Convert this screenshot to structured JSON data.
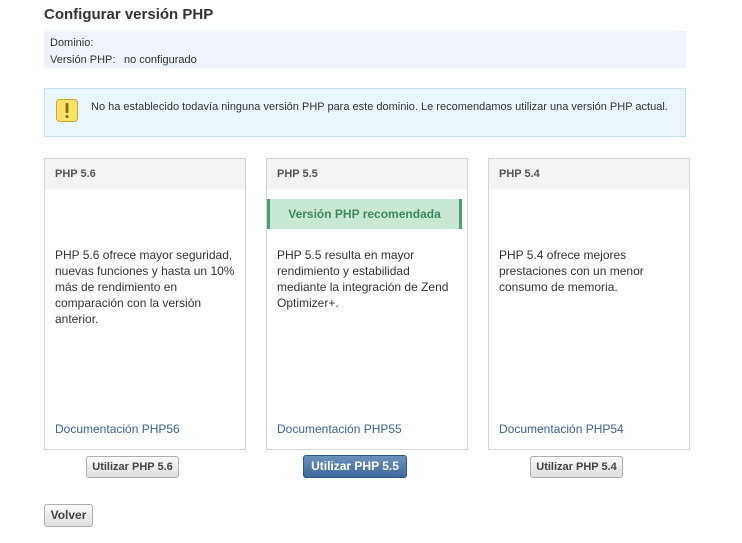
{
  "page": {
    "title": "Configurar versión PHP"
  },
  "info": {
    "domain_label": "Dominio:",
    "domain_value": "",
    "php_label": "Versión PHP:",
    "php_value": "no configurado"
  },
  "alert": {
    "icon": "warning-icon",
    "text": "No ha establecido todavía ninguna versión PHP para este dominio. Le recomendamos utilizar una versión PHP actual."
  },
  "cards": [
    {
      "title": "PHP 5.6",
      "recommended": "",
      "description": "PHP 5.6 ofrece mayor seguridad, nuevas funciones y hasta un 10% más de rendimiento en comparación con la versión anterior.",
      "doc_link": "Documentación PHP56",
      "button": "Utilizar PHP 5.6"
    },
    {
      "title": "PHP 5.5",
      "recommended": "Versión PHP recomendada",
      "description": "PHP 5.5 resulta en mayor rendimiento y estabilidad mediante la integración de Zend Optimizer+.",
      "doc_link": "Documentación PHP55",
      "button": "Utilizar PHP 5.5"
    },
    {
      "title": "PHP 5.4",
      "recommended": "",
      "description": "PHP 5.4 ofrece mejores prestaciones con un menor consumo de memoria.",
      "doc_link": "Documentación PHP54",
      "button": "Utilizar PHP 5.4"
    }
  ],
  "footer": {
    "back_button": "Volver"
  },
  "colors": {
    "primary_button": "#3f6a9c",
    "recommended_bg": "#c8e8d3",
    "recommended_text": "#3c8a5d",
    "link": "#3b6393",
    "alert_bg": "#eaf6fc"
  }
}
